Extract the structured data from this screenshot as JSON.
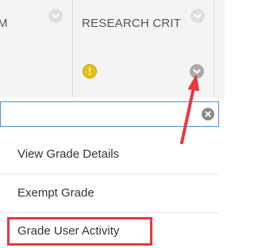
{
  "grid": {
    "headers": [
      {
        "label": "M"
      },
      {
        "label": "RESEARCH CRIT"
      }
    ]
  },
  "search": {
    "value": "",
    "placeholder": ""
  },
  "menu": {
    "items": [
      {
        "label": "View Grade Details"
      },
      {
        "label": "Exempt Grade"
      },
      {
        "label": "Grade User Activity"
      }
    ]
  },
  "icons": {
    "warning": "exclamation-circle",
    "column_menu": "chevron-down-circle",
    "clear": "close-circle"
  },
  "colors": {
    "header_bg": "#f4f4f4",
    "warning": "#e8c117",
    "annotation": "#e8383d",
    "focus_border": "#4a90d9"
  }
}
